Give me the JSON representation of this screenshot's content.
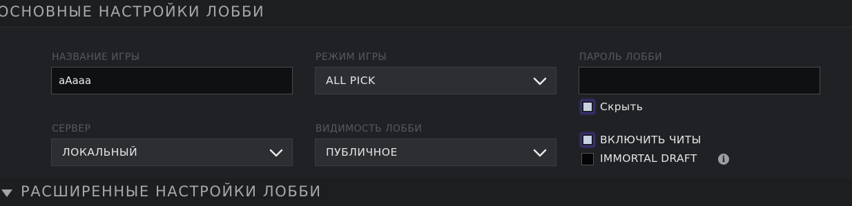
{
  "basic_section": {
    "title": "ОСНОВНЫЕ НАСТРОЙКИ ЛОББИ"
  },
  "game_name": {
    "label": "НАЗВАНИЕ ИГРЫ",
    "value": "aAaaa"
  },
  "game_mode": {
    "label": "РЕЖИМ ИГРЫ",
    "selected": "ALL PICK",
    "icon": "chevron-down-icon"
  },
  "lobby_password": {
    "label": "ПАРОЛЬ ЛОББИ",
    "value": ""
  },
  "hide_password": {
    "label": "Скрыть",
    "checked": true
  },
  "server": {
    "label": "СЕРВЕР",
    "selected": "ЛОКАЛЬНЫЙ",
    "icon": "chevron-down-icon"
  },
  "lobby_visibility": {
    "label": "ВИДИМОСТЬ ЛОББИ",
    "selected": "ПУБЛИЧНОЕ",
    "icon": "chevron-down-icon"
  },
  "enable_cheats": {
    "label": "ВКЛЮЧИТЬ ЧИТЫ",
    "checked": true
  },
  "immortal_draft": {
    "label": "IMMORTAL DRAFT",
    "checked": false,
    "info_icon": "i"
  },
  "advanced_section": {
    "title": "РАСШИРЕННЫЕ НАСТРОЙКИ ЛОББИ",
    "icon": "triangle-down-icon",
    "collapsed": true
  },
  "colors": {
    "background": "#1d1e20",
    "panel": "#202124",
    "label": "#56595d",
    "title": "#a5a8ab",
    "checkbox_glow": "#4a3fa0"
  }
}
